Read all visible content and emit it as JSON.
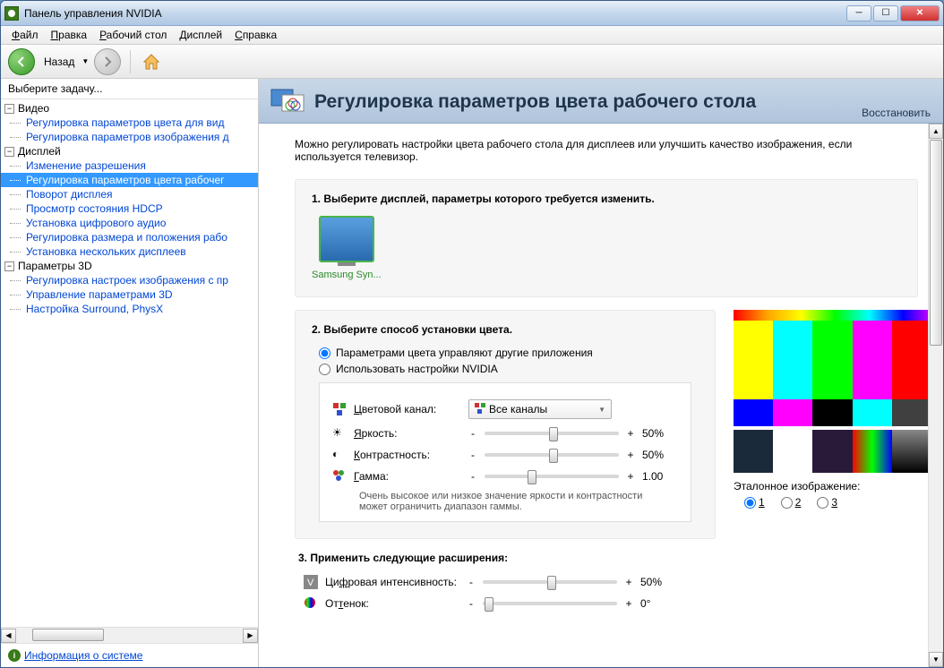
{
  "window": {
    "title": "Панель управления NVIDIA"
  },
  "menu": {
    "file": "Файл",
    "edit": "Правка",
    "desktop": "Рабочий стол",
    "display": "Дисплей",
    "help": "Справка"
  },
  "toolbar": {
    "back": "Назад"
  },
  "sidebar": {
    "header": "Выберите задачу...",
    "cat_video": "Видео",
    "video_items": [
      "Регулировка параметров цвета для вид",
      "Регулировка параметров изображения д"
    ],
    "cat_display": "Дисплей",
    "display_items": [
      "Изменение разрешения",
      "Регулировка параметров цвета рабочег",
      "Поворот дисплея",
      "Просмотр состояния HDCP",
      "Установка цифрового аудио",
      "Регулировка размера и положения рабо",
      "Установка нескольких дисплеев"
    ],
    "cat_3d": "Параметры 3D",
    "p3d_items": [
      "Регулировка настроек изображения с пр",
      "Управление параметрами 3D",
      "Настройка Surround, PhysX"
    ],
    "selected_index": 1
  },
  "footer": {
    "sysinfo": "Информация о системе"
  },
  "header": {
    "title": "Регулировка параметров цвета рабочего стола",
    "restore": "Восстановить"
  },
  "desc": "Можно регулировать настройки цвета рабочего стола для дисплеев или улучшить качество изображения, если используется телевизор.",
  "section1": {
    "title": "1. Выберите дисплей, параметры которого требуется изменить.",
    "display_name": "Samsung Syn..."
  },
  "section2": {
    "title": "2. Выберите способ установки цвета.",
    "radio1": "Параметрами цвета управляют другие приложения",
    "radio2": "Использовать настройки NVIDIA",
    "channel_label": "Цветовой канал:",
    "channel_value": "Все каналы",
    "brightness_label": "Яркость:",
    "brightness_value": "50%",
    "contrast_label": "Контрастность:",
    "contrast_value": "50%",
    "gamma_label": "Гамма:",
    "gamma_value": "1.00",
    "note": "Очень высокое или низкое значение яркости и контрастности может ограничить диапазон гаммы."
  },
  "section3": {
    "title": "3. Применить следующие расширения:",
    "vibrance_label": "Цифровая интенсивность:",
    "vibrance_value": "50%",
    "hue_label": "Оттенок:",
    "hue_value": "0°"
  },
  "reference": {
    "label": "Эталонное изображение:",
    "opt1": "1",
    "opt2": "2",
    "opt3": "3"
  }
}
